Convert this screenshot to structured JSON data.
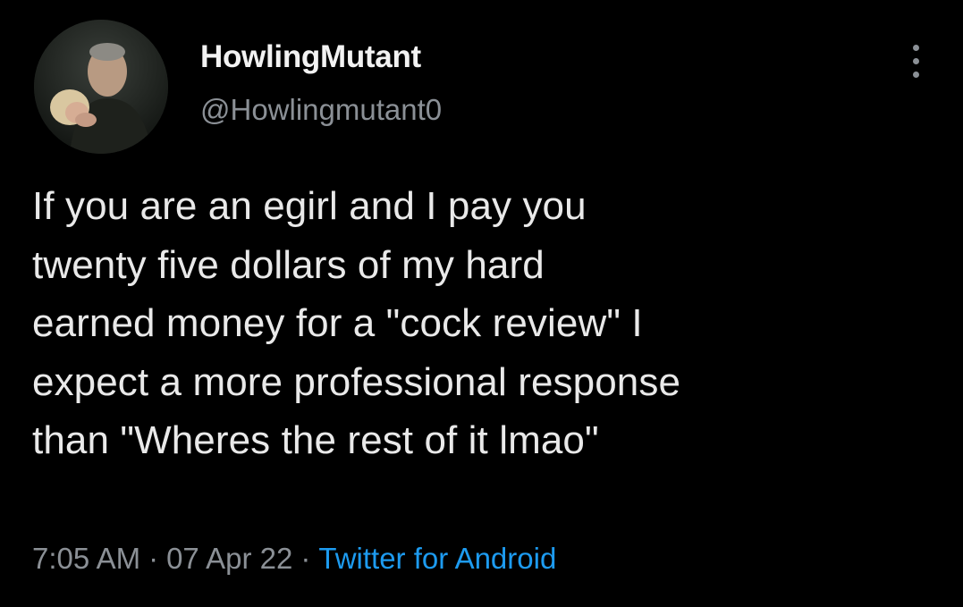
{
  "author": {
    "display_name": "HowlingMutant",
    "handle": "@Howlingmutant0",
    "avatar_icon": "avatar-photo"
  },
  "more_icon": "more-horizontal-icon",
  "tweet": {
    "lines": [
      "If you are an egirl and I pay you",
      "twenty five dollars of my hard",
      "earned money for a \"cock review\" I",
      "expect a more professional response",
      "than \"Wheres the rest of it lmao\""
    ]
  },
  "meta": {
    "time": "7:05 AM",
    "separator": "·",
    "date": "07 Apr 22",
    "source": "Twitter for Android"
  },
  "colors": {
    "background": "#000000",
    "text": "#e7e9ea",
    "muted": "#8b9096",
    "link": "#1d9bf0"
  }
}
